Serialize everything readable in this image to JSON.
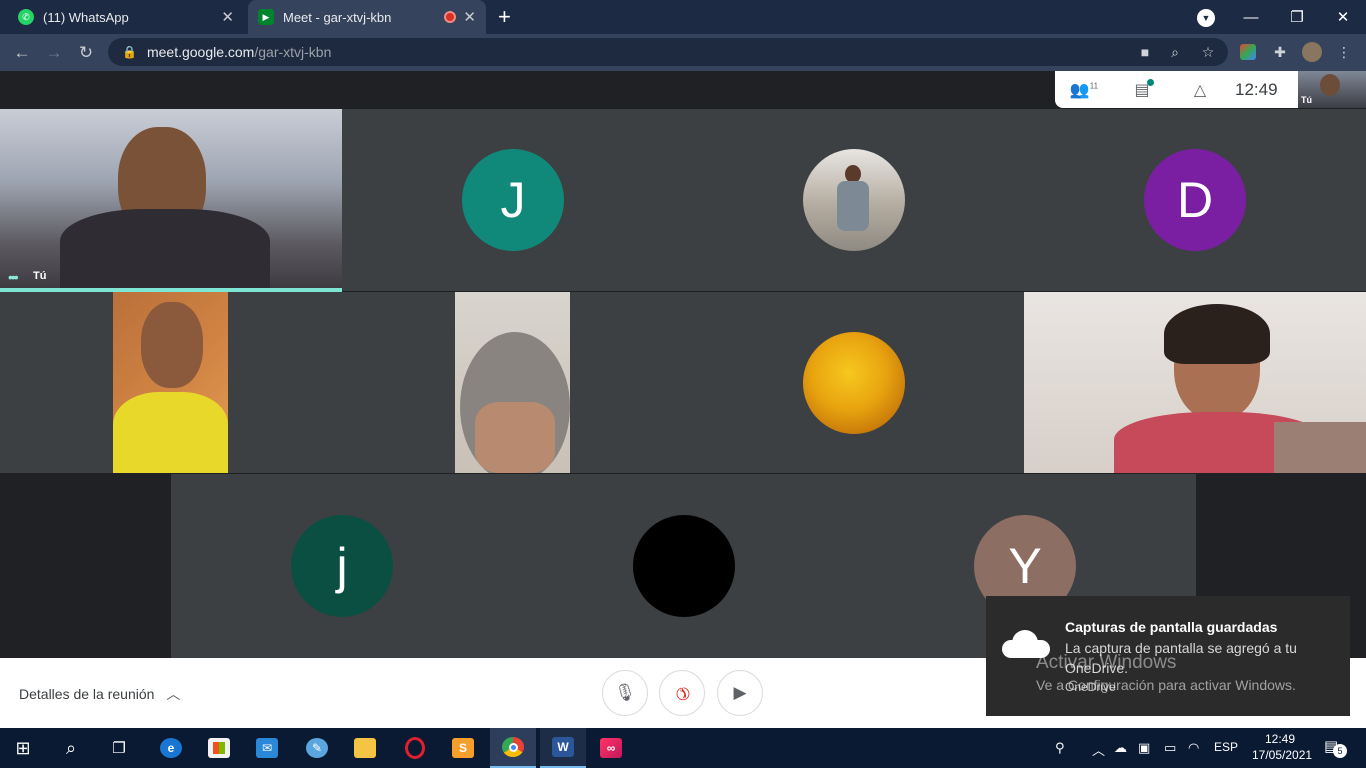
{
  "browser": {
    "tabs": [
      {
        "title": "(11) WhatsApp",
        "badge": "11"
      },
      {
        "title": "Meet - gar-xtvj-kbn"
      }
    ],
    "url_host": "meet.google.com",
    "url_path": "/gar-xtvj-kbn"
  },
  "meet": {
    "participants_count": "11",
    "clock": "12:49",
    "self_label": "Tú",
    "tiles": {
      "self_label": "Tú",
      "j1_initial": "J",
      "d_initial": "D",
      "j2_initial": "j",
      "y_initial": "Y"
    },
    "meeting_details": "Detalles de la reunión"
  },
  "colors": {
    "avatar_j": "#10897b",
    "avatar_d": "#7b1fa2",
    "avatar_j2": "#0b4f43",
    "avatar_y": "#8d6e63",
    "hangup": "#d93025"
  },
  "toast": {
    "title": "Capturas de pantalla guardadas",
    "body": "La captura de pantalla se agregó a tu OneDrive.",
    "source": "OneDrive",
    "watermark_title": "Activar Windows",
    "watermark_body": "Ve a Configuración para activar Windows."
  },
  "taskbar": {
    "lang": "ESP",
    "time": "12:49",
    "date": "17/05/2021",
    "notifications": "5"
  }
}
